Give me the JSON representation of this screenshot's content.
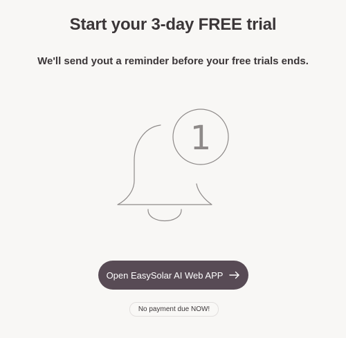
{
  "header": {
    "title": "Start your 3-day FREE trial",
    "subtitle": "We'll send yout a reminder before your free trials ends."
  },
  "illustration": {
    "icon": "bell-notification-icon",
    "badge_number": "1"
  },
  "cta": {
    "label": "Open EasySolar AI Web APP",
    "icon": "arrow-right-icon"
  },
  "note": {
    "text": "No payment due NOW!"
  },
  "colors": {
    "background": "#f8f7f5",
    "text": "#3b3638",
    "button": "#584b55",
    "button_text": "#ffffff"
  }
}
